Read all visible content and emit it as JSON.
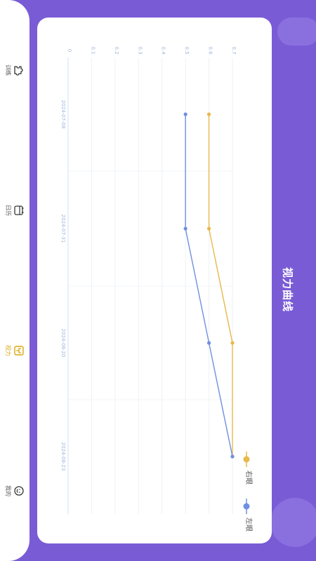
{
  "page_title": "视力曲线",
  "tabbar": {
    "items": [
      {
        "key": "training",
        "label": "训练",
        "icon": "puzzle-icon",
        "active": false
      },
      {
        "key": "calendar",
        "label": "日历",
        "icon": "calendar-icon",
        "active": false
      },
      {
        "key": "vision",
        "label": "视力",
        "icon": "eye-chart-icon",
        "active": true
      },
      {
        "key": "mine",
        "label": "我的",
        "icon": "smiley-icon",
        "active": false
      }
    ]
  },
  "colors": {
    "background": "#7a5bd6",
    "right_eye": "#e8b84a",
    "left_eye": "#6f8fe0",
    "active_tab": "#d9a70f"
  },
  "chart_data": {
    "type": "line",
    "title": "视力曲线",
    "x": [
      "2024-07-08",
      "2024-07-31",
      "2024-08-20",
      "2024-08-23"
    ],
    "series": [
      {
        "name": "右眼",
        "values": [
          0.6,
          0.6,
          0.7,
          0.7
        ]
      },
      {
        "name": "左眼",
        "values": [
          0.5,
          0.5,
          0.6,
          0.7
        ]
      }
    ],
    "ylim": [
      0,
      0.7
    ],
    "yticks": [
      "0",
      "0.1",
      "0.2",
      "0.3",
      "0.4",
      "0.5",
      "0.6",
      "0.7"
    ],
    "grid": true,
    "legend": "bottom"
  }
}
